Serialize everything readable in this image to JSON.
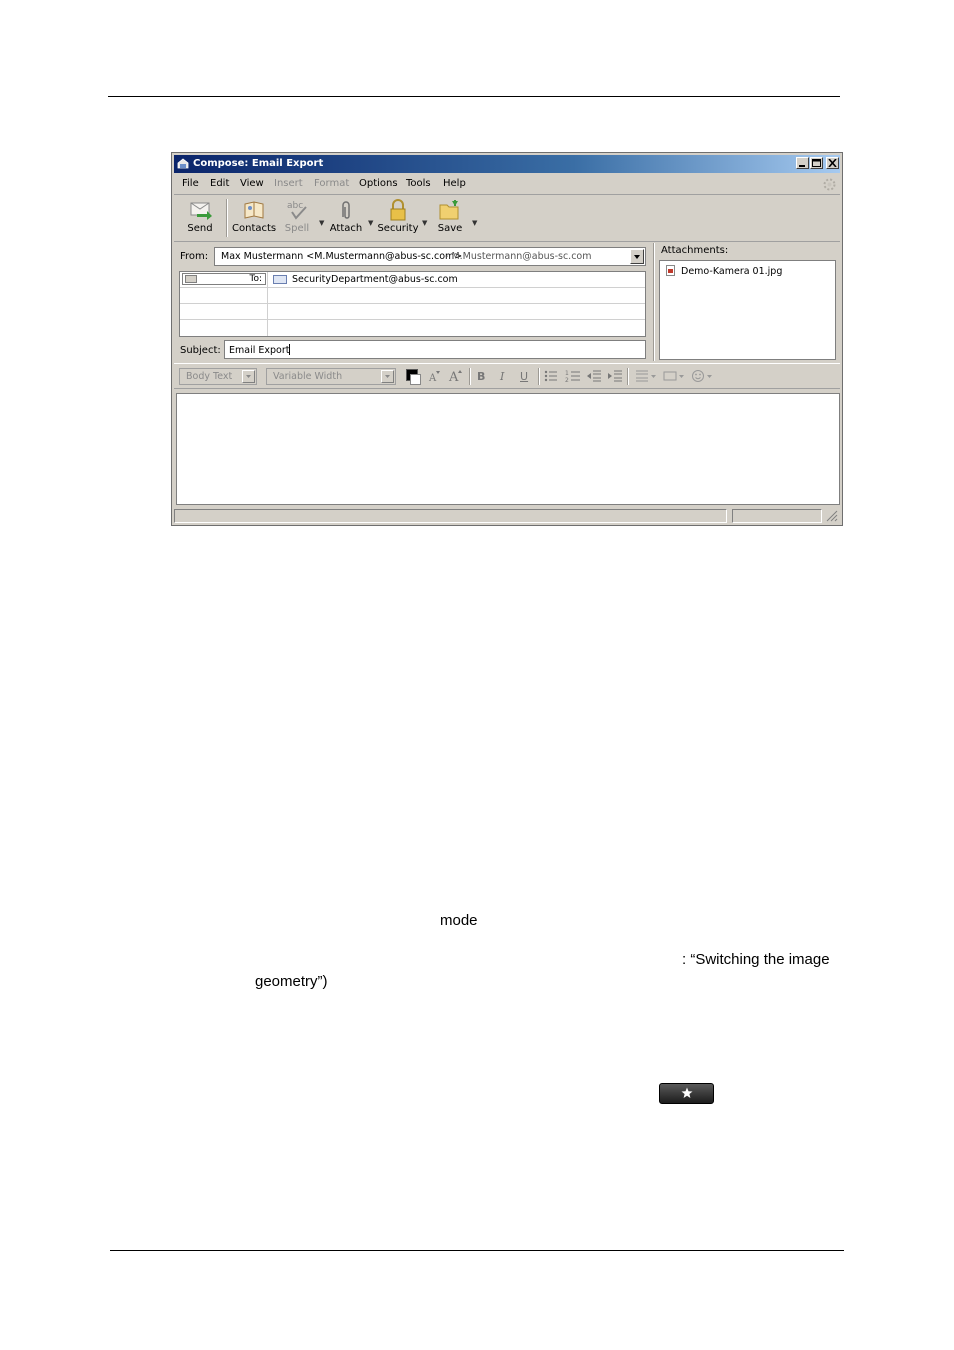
{
  "window": {
    "title": "Compose: Email Export"
  },
  "menu": [
    {
      "label": "File",
      "enabled": true
    },
    {
      "label": "Edit",
      "enabled": true
    },
    {
      "label": "View",
      "enabled": true
    },
    {
      "label": "Insert",
      "enabled": false
    },
    {
      "label": "Format",
      "enabled": false
    },
    {
      "label": "Options",
      "enabled": true
    },
    {
      "label": "Tools",
      "enabled": true
    },
    {
      "label": "Help",
      "enabled": true
    }
  ],
  "toolbar": {
    "send": "Send",
    "contacts": "Contacts",
    "spell": "Spell",
    "attach": "Attach",
    "security": "Security",
    "save": "Save"
  },
  "from": {
    "label": "From:",
    "name": "Max Mustermann <M.Mustermann@abus-sc.com>",
    "account": "- M.Mustermann@abus-sc.com"
  },
  "recipients": [
    {
      "type": "To:",
      "address": "SecurityDepartment@abus-sc.com"
    }
  ],
  "subject": {
    "label": "Subject:",
    "value": "Email Export"
  },
  "attachments": {
    "label": "Attachments:",
    "items": [
      "Demo-Kamera 01.jpg"
    ]
  },
  "format": {
    "paragraph": "Body Text",
    "font": "Variable Width",
    "bold": "B",
    "italic": "I",
    "underline": "U"
  },
  "document": {
    "mode_text": "mode",
    "switch_text_1": ": “Switching the image",
    "switch_text_2": "geometry”)"
  },
  "colors": {
    "titlebar": "#0a246a",
    "window_bg": "#d4d0c8"
  }
}
